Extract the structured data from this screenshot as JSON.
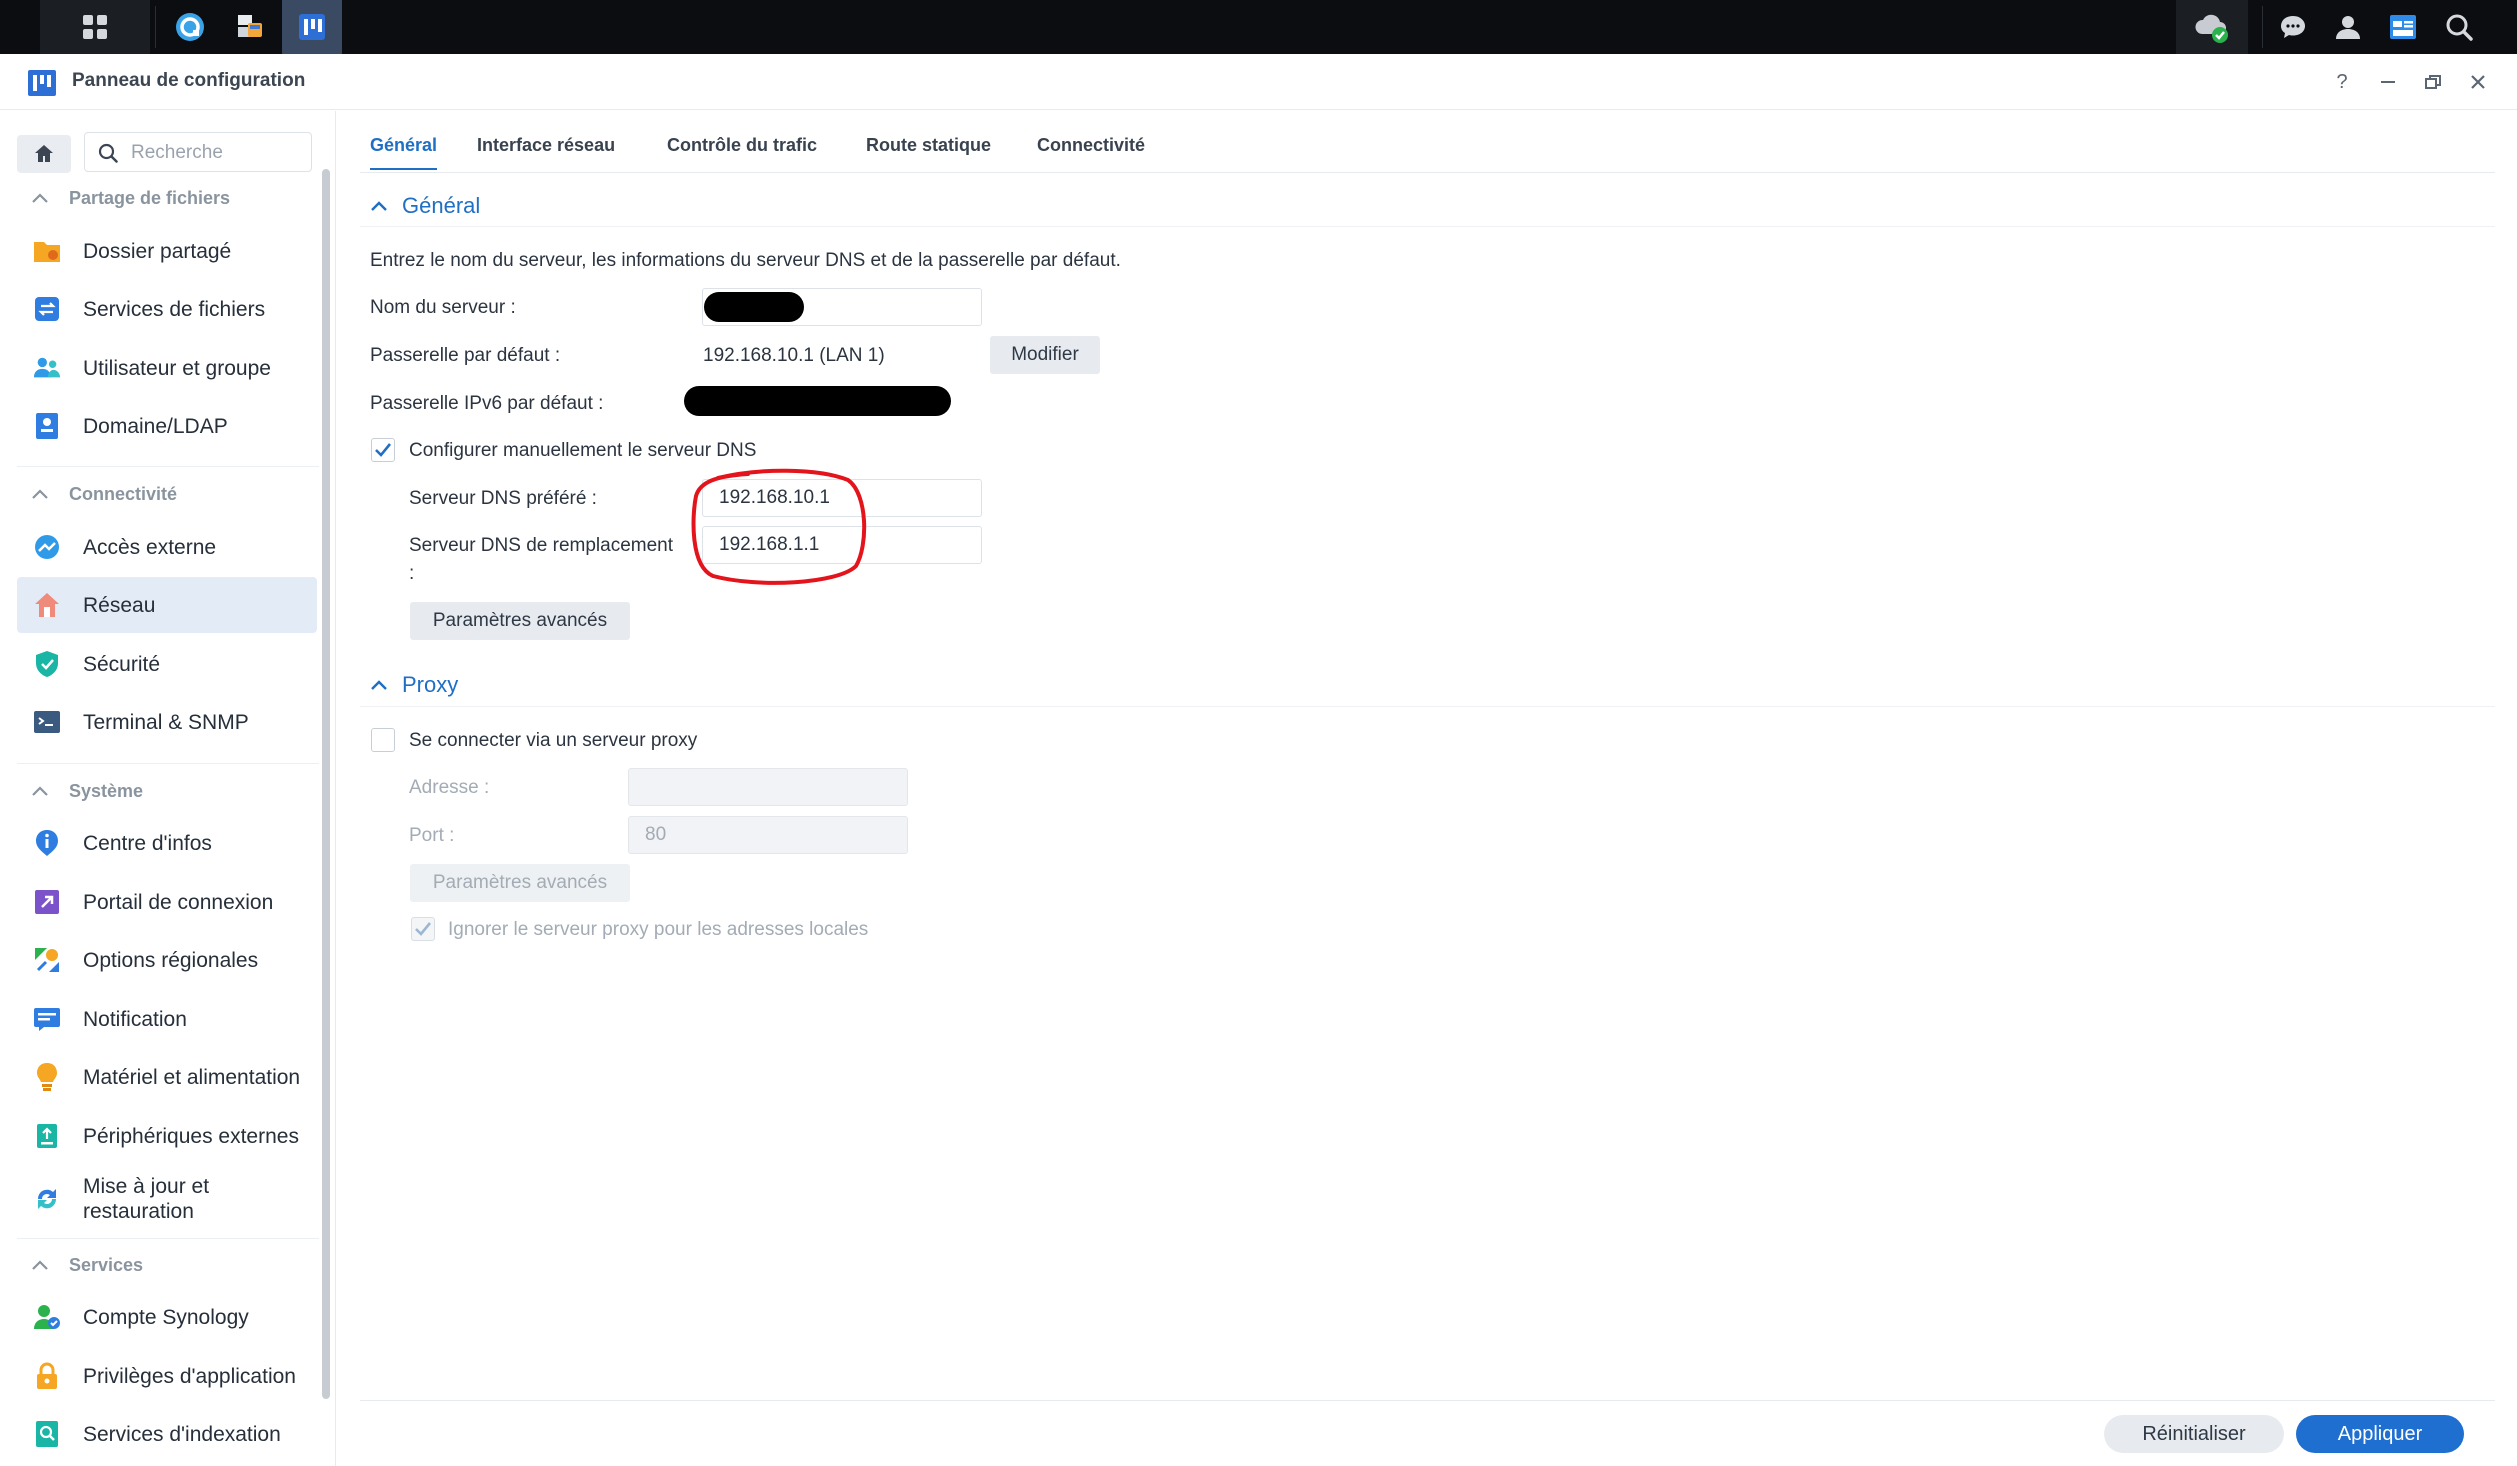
{
  "window": {
    "title": "Panneau de configuration"
  },
  "taskbar": {
    "left_icons": [
      "apps-grid-icon",
      "synology-drive-icon",
      "package-center-icon",
      "control-panel-icon"
    ],
    "right_icons": [
      "cloud-sync-icon",
      "chat-icon",
      "user-icon",
      "widgets-icon",
      "search-icon"
    ]
  },
  "sidebar": {
    "search_placeholder": "Recherche",
    "sections": [
      {
        "title": "Partage de fichiers",
        "items": [
          {
            "label": "Dossier partagé",
            "icon": "shared-folder-icon"
          },
          {
            "label": "Services de fichiers",
            "icon": "file-services-icon"
          },
          {
            "label": "Utilisateur et groupe",
            "icon": "user-group-icon"
          },
          {
            "label": "Domaine/LDAP",
            "icon": "domain-ldap-icon"
          }
        ]
      },
      {
        "title": "Connectivité",
        "items": [
          {
            "label": "Accès externe",
            "icon": "external-access-icon"
          },
          {
            "label": "Réseau",
            "icon": "network-icon",
            "active": true
          },
          {
            "label": "Sécurité",
            "icon": "security-icon"
          },
          {
            "label": "Terminal & SNMP",
            "icon": "terminal-icon"
          }
        ]
      },
      {
        "title": "Système",
        "items": [
          {
            "label": "Centre d'infos",
            "icon": "info-center-icon"
          },
          {
            "label": "Portail de connexion",
            "icon": "login-portal-icon"
          },
          {
            "label": "Options régionales",
            "icon": "regional-options-icon"
          },
          {
            "label": "Notification",
            "icon": "notification-icon"
          },
          {
            "label": "Matériel et alimentation",
            "icon": "hardware-power-icon"
          },
          {
            "label": "Périphériques externes",
            "icon": "external-devices-icon"
          },
          {
            "label": "Mise à jour et restauration",
            "icon": "update-restore-icon"
          }
        ]
      },
      {
        "title": "Services",
        "items": [
          {
            "label": "Compte Synology",
            "icon": "synology-account-icon"
          },
          {
            "label": "Privilèges d'application",
            "icon": "app-privileges-icon"
          },
          {
            "label": "Services d'indexation",
            "icon": "indexing-service-icon"
          }
        ]
      }
    ]
  },
  "tabs": [
    "Général",
    "Interface réseau",
    "Contrôle du trafic",
    "Route statique",
    "Connectivité"
  ],
  "general": {
    "title": "Général",
    "description": "Entrez le nom du serveur, les informations du serveur DNS et de la passerelle par défaut.",
    "server_name_label": "Nom du serveur :",
    "gateway_label": "Passerelle par défaut :",
    "gateway_value": "192.168.10.1 (LAN 1)",
    "modify_button": "Modifier",
    "ipv6_gateway_label": "Passerelle IPv6 par défaut :",
    "manual_dns_label": "Configurer manuellement le serveur DNS",
    "manual_dns_checked": true,
    "preferred_dns_label": "Serveur DNS préféré :",
    "preferred_dns_value": "192.168.10.1",
    "alternate_dns_label_1": "Serveur DNS de remplacement",
    "alternate_dns_label_2": ":",
    "alternate_dns_value": "192.168.1.1",
    "advanced_button": "Paramètres avancés"
  },
  "proxy": {
    "title": "Proxy",
    "connect_label": "Se connecter via un serveur proxy",
    "connect_checked": false,
    "address_label": "Adresse :",
    "address_value": "",
    "port_label": "Port :",
    "port_value": "80",
    "advanced_button": "Paramètres avancés",
    "bypass_label": "Ignorer le serveur proxy pour les adresses locales",
    "bypass_checked": true
  },
  "footer": {
    "reset_button": "Réinitialiser",
    "apply_button": "Appliquer"
  },
  "colors": {
    "accent": "#1f6fc4",
    "primary_button": "#1f6fd0",
    "annotation_circle": "#e3141b",
    "active_nav_bg": "#e3ecf6"
  }
}
